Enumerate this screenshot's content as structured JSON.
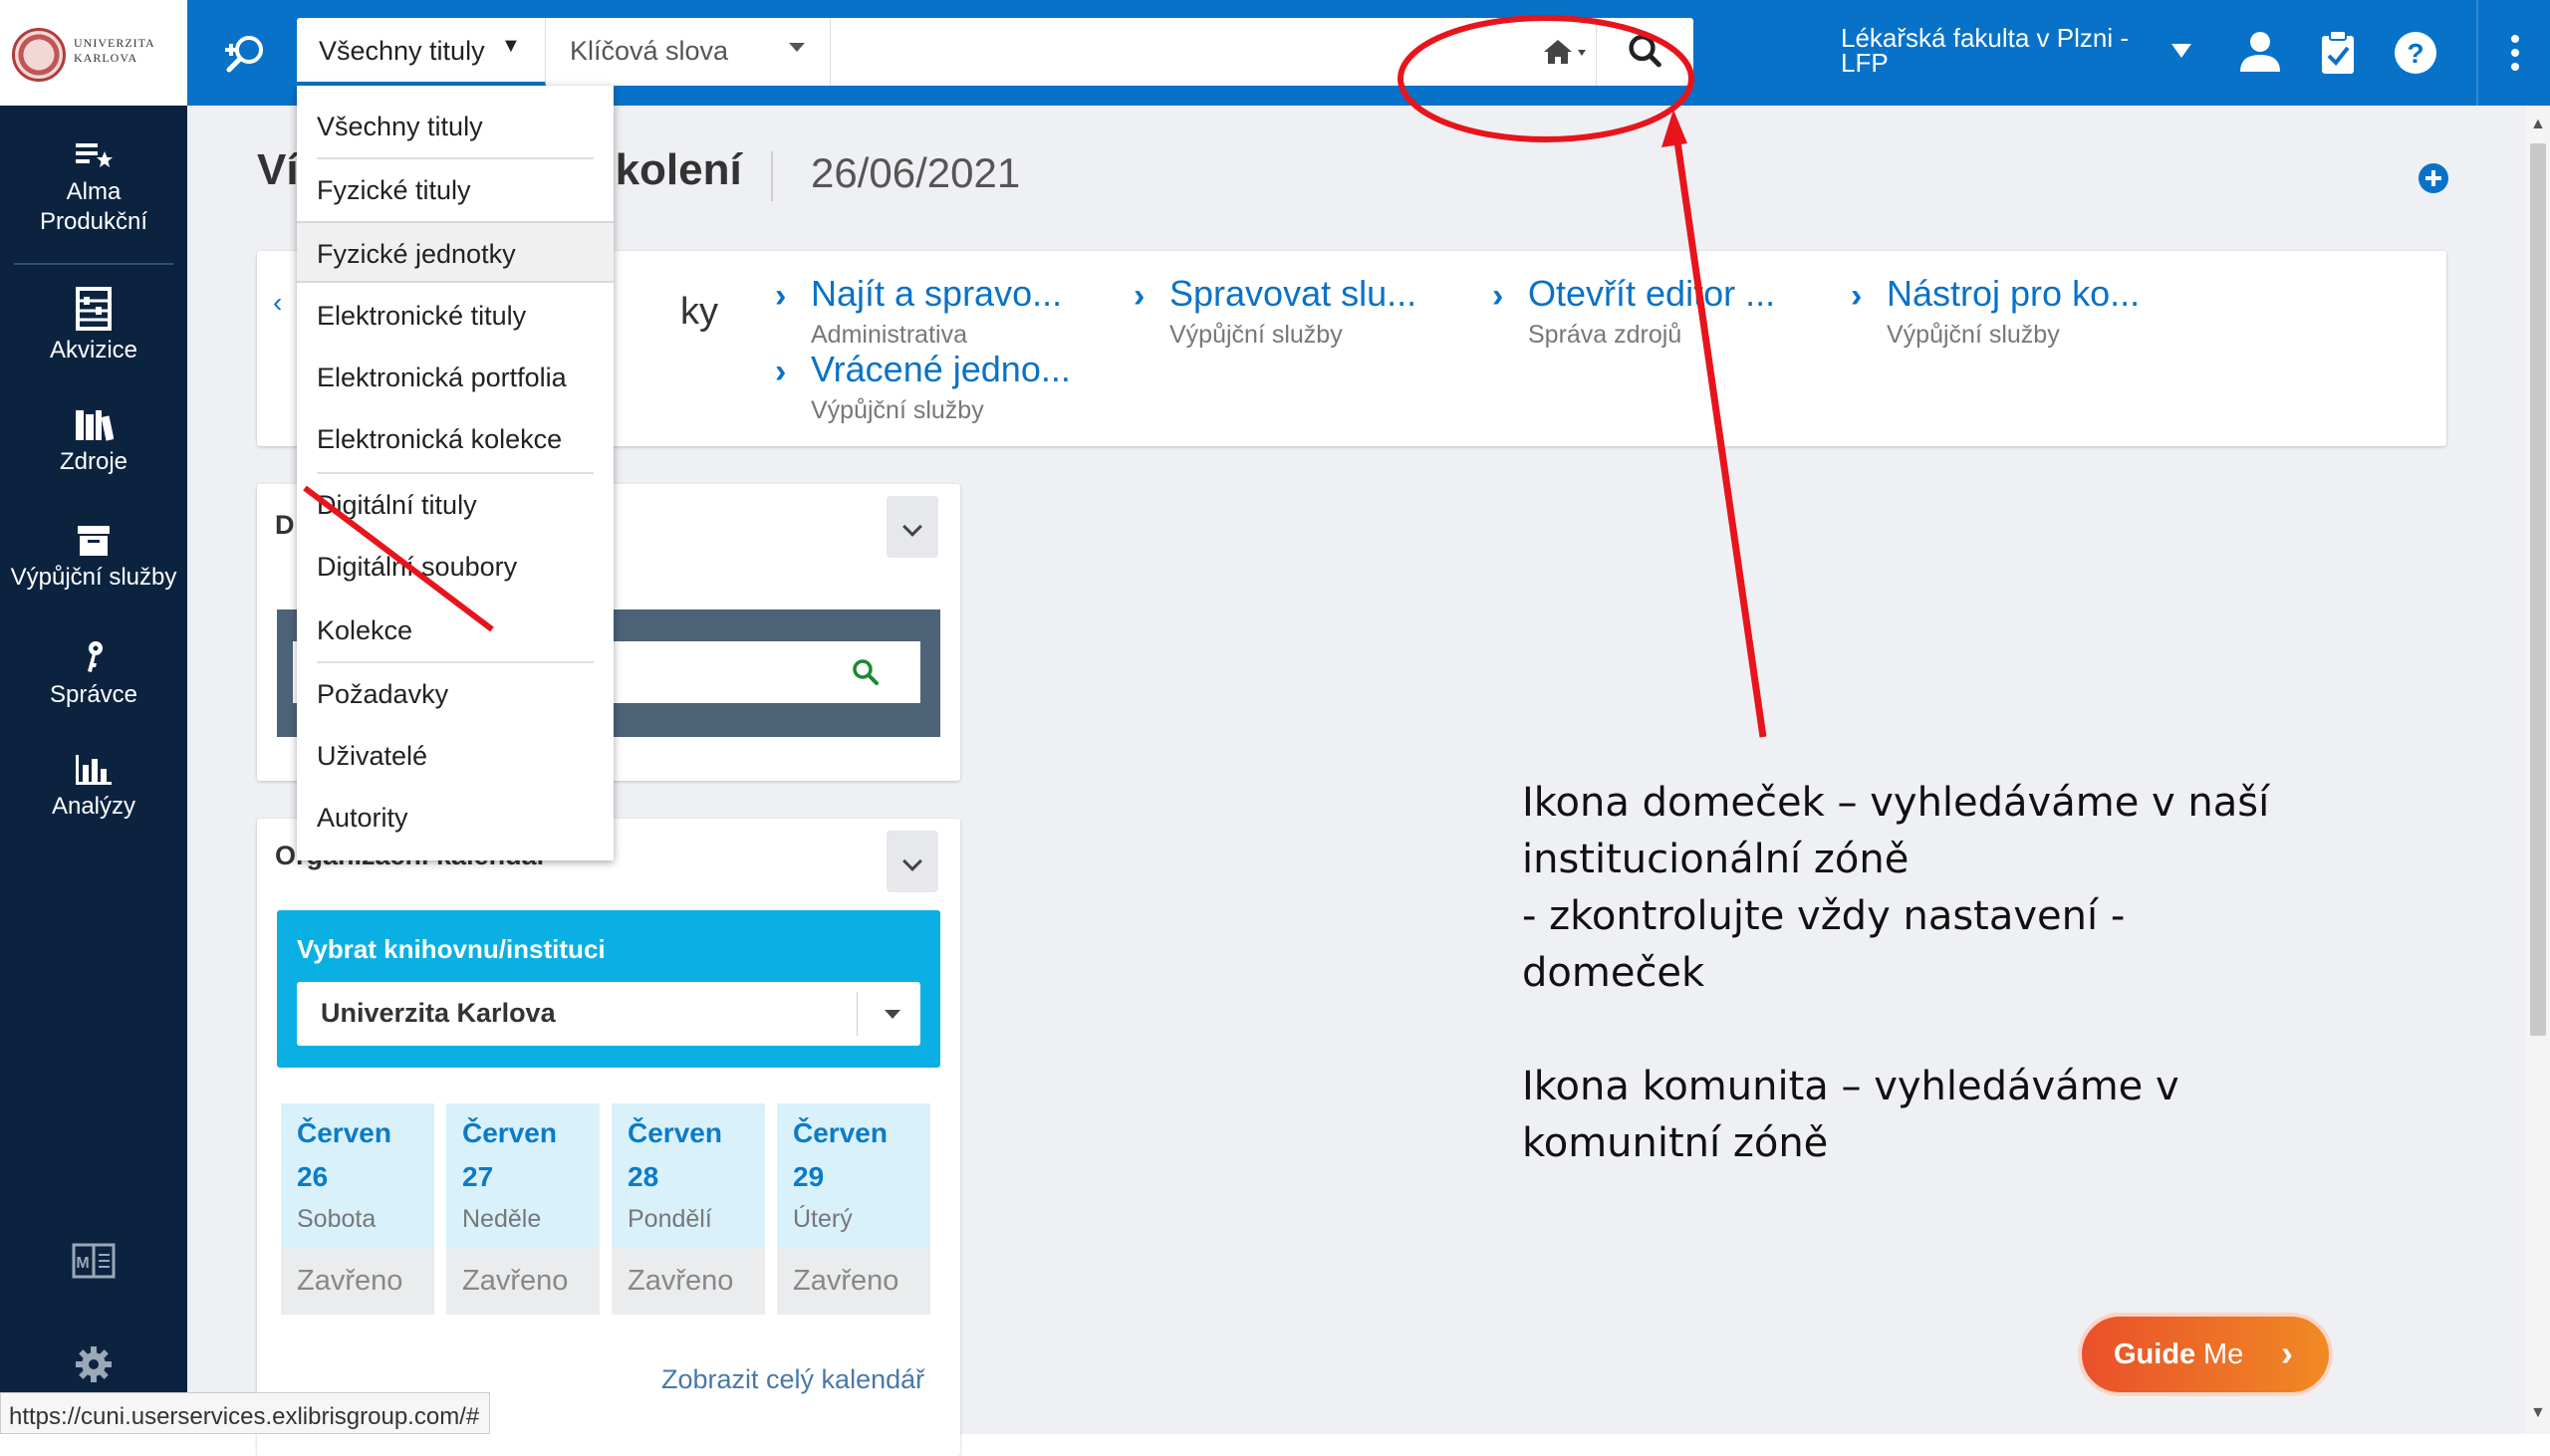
{
  "logo": {
    "line1": "UNIVERZITA",
    "line2": "KARLOVA"
  },
  "search": {
    "scope_label": "Všechny tituly",
    "field_label": "Klíčová slova",
    "placeholder": ""
  },
  "institution": {
    "name": "Lékařská fakulta v Plzni - LFP"
  },
  "scope_menu": {
    "items": [
      "Všechny tituly",
      "Fyzické tituly",
      "Fyzické jednotky",
      "Elektronické tituly",
      "Elektronická portfolia",
      "Elektronická kolekce",
      "Digitální tituly",
      "Digitální soubory",
      "Kolekce",
      "Požadavky",
      "Uživatelé",
      "Autority"
    ]
  },
  "sidebar": {
    "items": [
      {
        "label": "Alma Produkční",
        "icon": "star-list-icon"
      },
      {
        "label": "Akvizice",
        "icon": "abacus-icon"
      },
      {
        "label": "Zdroje",
        "icon": "books-icon"
      },
      {
        "label": "Výpůjční služby",
        "icon": "archive-box-icon"
      },
      {
        "label": "Správce",
        "icon": "key-icon"
      },
      {
        "label": "Analýzy",
        "icon": "bar-chart-icon"
      }
    ],
    "bottom_icons": [
      "manual-icon",
      "gear-icon"
    ]
  },
  "header": {
    "title_left": "Ví",
    "title_right": "kolení",
    "date": "26/06/2021"
  },
  "quick_links": {
    "partial": "ky",
    "items": [
      {
        "title": "Najít a spravo...",
        "sub": "Administrativa"
      },
      {
        "title": "Vrácené jedno...",
        "sub": "Výpůjční služby"
      },
      {
        "title": "Spravovat slu...",
        "sub": "Výpůjční služby"
      },
      {
        "title": "Otevřít editor ...",
        "sub": "Správa zdrojů"
      },
      {
        "title": "Nástroj pro ko...",
        "sub": "Výpůjční služby"
      }
    ]
  },
  "widget_search": {
    "title_letter": "D"
  },
  "calendar": {
    "title": "Organizační kalendář",
    "library_label": "Vybrat knihovnu/instituci",
    "library_value": "Univerzita Karlova",
    "days": [
      {
        "month": "Červen",
        "num": "26",
        "name": "Sobota",
        "status": "Zavřeno"
      },
      {
        "month": "Červen",
        "num": "27",
        "name": "Neděle",
        "status": "Zavřeno"
      },
      {
        "month": "Červen",
        "num": "28",
        "name": "Pondělí",
        "status": "Zavřeno"
      },
      {
        "month": "Červen",
        "num": "29",
        "name": "Úterý",
        "status": "Zavřeno"
      }
    ],
    "show_all": "Zobrazit celý kalendář"
  },
  "annotation": {
    "line1": "Ikona domeček – vyhledáváme v naší institucionální zóně",
    "line2": "- zkontrolujte vždy nastavení - domeček",
    "line3": "Ikona komunita – vyhledáváme v komunitní zóně"
  },
  "guideme": {
    "part1": "Guide",
    "part2": "Me"
  },
  "status_url": "https://cuni.userservices.exlibrisgroup.com/#",
  "colors": {
    "brand_blue": "#0872c8",
    "sidebar": "#0c2340",
    "annotation_red": "#e8141c",
    "guideme": "#f0642a"
  }
}
